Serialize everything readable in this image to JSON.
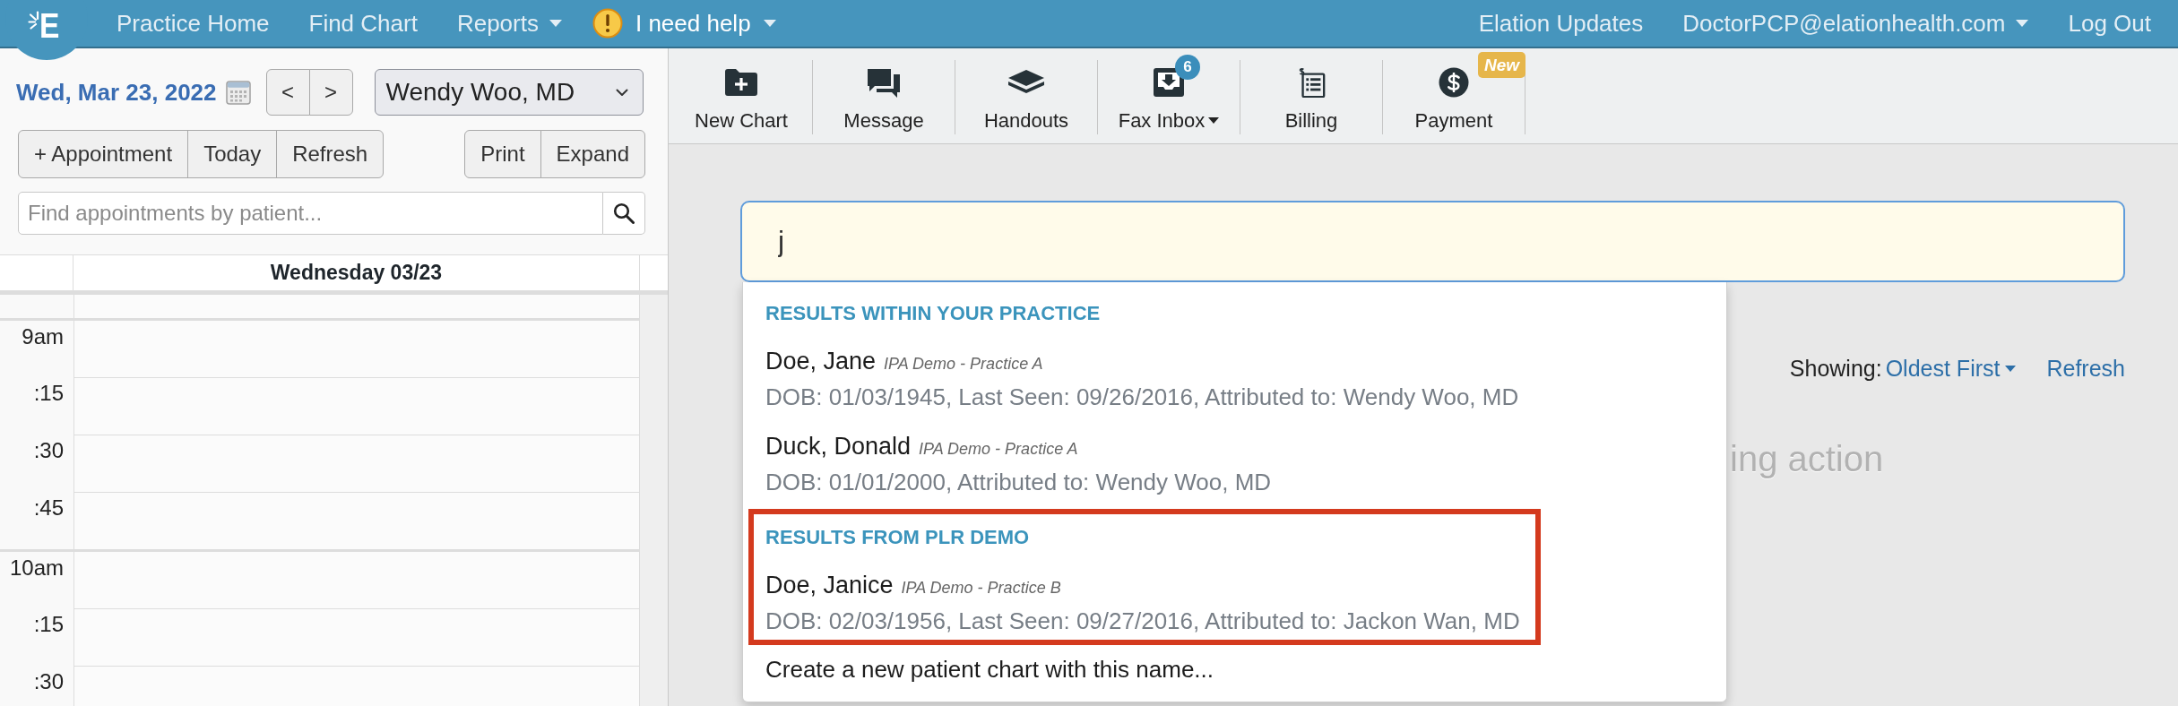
{
  "top_nav": {
    "logo": "E",
    "left": [
      {
        "label": "Practice Home",
        "kind": "link"
      },
      {
        "label": "Find Chart",
        "kind": "link"
      },
      {
        "label": "Reports",
        "kind": "menu"
      },
      {
        "label": "I need help",
        "kind": "help_menu"
      }
    ],
    "right": [
      {
        "label": "Elation Updates",
        "kind": "link"
      },
      {
        "label": "DoctorPCP@elationhealth.com",
        "kind": "menu"
      },
      {
        "label": "Log Out",
        "kind": "link"
      }
    ]
  },
  "schedule": {
    "date": "Wed, Mar 23, 2022",
    "nav_buttons": [
      "<",
      ">"
    ],
    "provider": "Wendy Woo, MD",
    "actions": [
      "+ Appointment",
      "Today",
      "Refresh"
    ],
    "view_actions": [
      "Print",
      "Expand"
    ],
    "search": {
      "placeholder": "Find appointments by patient..."
    },
    "day_header": "Wednesday 03/23",
    "time_slots": [
      {
        "label": "9am",
        "kind": "hour"
      },
      {
        "label": ":15",
        "kind": "quarter"
      },
      {
        "label": ":30",
        "kind": "quarter"
      },
      {
        "label": ":45",
        "kind": "quarter"
      },
      {
        "label": "10am",
        "kind": "hour"
      },
      {
        "label": ":15",
        "kind": "quarter"
      },
      {
        "label": ":30",
        "kind": "quarter"
      }
    ]
  },
  "toolbar": [
    {
      "label": "New Chart",
      "menu": false
    },
    {
      "label": "Message",
      "menu": false
    },
    {
      "label": "Handouts",
      "menu": false
    },
    {
      "label": "Fax Inbox",
      "menu": true,
      "badge": {
        "kind": "count",
        "text": "6"
      }
    },
    {
      "label": "Billing",
      "menu": false
    },
    {
      "label": "Payment",
      "menu": false,
      "badge": {
        "kind": "new",
        "text": "New"
      }
    }
  ],
  "patient_search": {
    "value": "j",
    "groups": [
      {
        "heading": "RESULTS WITHIN YOUR PRACTICE",
        "highlighted": false,
        "patients": [
          {
            "name": "Doe, Jane",
            "practice": "IPA Demo - Practice A",
            "details": "DOB: 01/03/1945, Last Seen: 09/26/2016, Attributed to: Wendy Woo, MD"
          },
          {
            "name": "Duck, Donald",
            "practice": "IPA Demo - Practice A",
            "details": "DOB: 01/01/2000, Attributed to: Wendy Woo, MD"
          }
        ]
      },
      {
        "heading": "RESULTS FROM PLR DEMO",
        "highlighted": true,
        "patients": [
          {
            "name": "Doe, Janice",
            "practice": "IPA Demo - Practice B",
            "details": "DOB: 02/03/1956, Last Seen: 09/27/2016, Attributed to: Jackon Wan, MD"
          }
        ]
      }
    ],
    "create_option": "Create a new patient chart with this name..."
  },
  "sort": {
    "label": "Showing:",
    "value": "Oldest First"
  },
  "refresh": "Refresh",
  "empty_message": "ing action"
}
